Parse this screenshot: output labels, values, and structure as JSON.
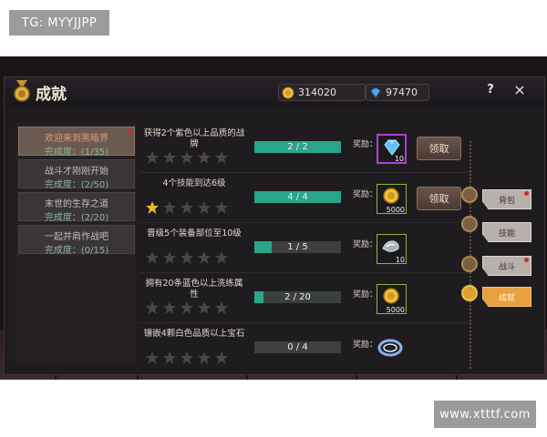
{
  "watermarks": {
    "top": "TG: MYYJJPP",
    "bottom": "www.xtttf.com"
  },
  "window": {
    "title": "成就"
  },
  "currency": {
    "gold": "314020",
    "gems": "97470"
  },
  "controls": {
    "help": "?",
    "close": "×"
  },
  "categories": [
    {
      "name": "欢迎来到黑暗界",
      "progress": "完成度：(1/35)",
      "active": true,
      "badge": true
    },
    {
      "name": "战斗才刚刚开始",
      "progress": "完成度：(2/50)",
      "active": false,
      "badge": false
    },
    {
      "name": "末世的生存之道",
      "progress": "完成度：(2/20)",
      "active": false,
      "badge": false
    },
    {
      "name": "一起并肩作战吧",
      "progress": "完成度：(0/15)",
      "active": false,
      "badge": false
    }
  ],
  "achievements": [
    {
      "desc": "获得2个紫色以上品质的战牌",
      "stars": 0,
      "progress_text": "2 / 2",
      "progress": 1.0,
      "reward_label": "奖励：",
      "reward_icon": "diamond-icon",
      "reward_qty": "10",
      "reward_frame": "purple",
      "claim": "领取"
    },
    {
      "desc": "4个技能到达6级",
      "stars": 1,
      "progress_text": "4 / 4",
      "progress": 1.0,
      "reward_label": "奖励：",
      "reward_icon": "gold-coin-icon",
      "reward_qty": "5000",
      "reward_frame": "gold",
      "claim": "领取"
    },
    {
      "desc": "晋级5个装备部位至10级",
      "stars": 0,
      "progress_text": "1 / 5",
      "progress": 0.2,
      "reward_label": "奖励：",
      "reward_icon": "steel-ore-icon",
      "reward_qty": "10",
      "reward_frame": "gold",
      "claim": ""
    },
    {
      "desc": "拥有20条蓝色以上洗练属性",
      "stars": 0,
      "progress_text": "2 / 20",
      "progress": 0.1,
      "reward_label": "奖励：",
      "reward_icon": "gold-coin-icon",
      "reward_qty": "5000",
      "reward_frame": "gold",
      "claim": ""
    },
    {
      "desc": "镶嵌4颗白色品质以上宝石",
      "stars": 0,
      "progress_text": "0 / 4",
      "progress": 0.0,
      "reward_label": "奖励：",
      "reward_icon": "ring-gem-icon",
      "reward_qty": "",
      "reward_frame": "none",
      "claim": ""
    }
  ],
  "side_tabs": [
    {
      "label": "背包",
      "active": false,
      "badge": true
    },
    {
      "label": "技能",
      "active": false,
      "badge": false
    },
    {
      "label": "战斗",
      "active": false,
      "badge": true
    },
    {
      "label": "成就",
      "active": true,
      "badge": false
    }
  ],
  "colors": {
    "progress_fill": "#2aa58a",
    "star_lit": "#f0b830",
    "star_dim": "#4a4648",
    "accent_tab": "#e8a040"
  }
}
